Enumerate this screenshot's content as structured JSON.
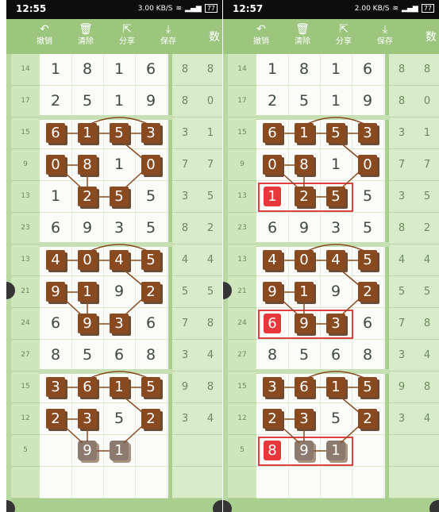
{
  "panels": [
    {
      "id": "left",
      "status": {
        "time": "12:55",
        "speed": "3.00 KB/S",
        "battery": "77"
      },
      "toolbar": [
        {
          "label": "撤销",
          "icon": "undo-icon",
          "glyph": "↶"
        },
        {
          "label": "清除",
          "icon": "trash-icon",
          "glyph": "🗑"
        },
        {
          "label": "分享",
          "icon": "share-icon",
          "glyph": "⇱"
        },
        {
          "label": "保存",
          "icon": "download-icon",
          "glyph": "⤓"
        }
      ],
      "toolbar_more": "数",
      "rows": [
        {
          "n": "14",
          "v": [
            "1",
            "8",
            "1",
            "6"
          ],
          "s": [
            "8",
            "8"
          ]
        },
        {
          "n": "17",
          "v": [
            "2",
            "5",
            "1",
            "9"
          ],
          "s": [
            "8",
            "0"
          ]
        },
        {
          "n": "15",
          "v": [
            "6",
            "1",
            "5",
            "3"
          ],
          "s": [
            "3",
            "1"
          ],
          "hl": [
            0,
            1,
            2,
            3
          ]
        },
        {
          "n": "9",
          "v": [
            "0",
            "8",
            "1",
            "0"
          ],
          "s": [
            "7",
            "7"
          ],
          "hl": [
            0,
            1,
            3
          ]
        },
        {
          "n": "13",
          "v": [
            "1",
            "2",
            "5",
            "5"
          ],
          "s": [
            "3",
            "5"
          ],
          "hl": [
            1,
            2
          ]
        },
        {
          "n": "23",
          "v": [
            "6",
            "9",
            "3",
            "5"
          ],
          "s": [
            "8",
            "2"
          ]
        },
        {
          "n": "13",
          "v": [
            "4",
            "0",
            "4",
            "5"
          ],
          "s": [
            "4",
            "4"
          ],
          "hl": [
            0,
            1,
            2,
            3
          ]
        },
        {
          "n": "21",
          "v": [
            "9",
            "1",
            "9",
            "2"
          ],
          "s": [
            "5",
            "5"
          ],
          "hl": [
            0,
            1,
            3
          ]
        },
        {
          "n": "24",
          "v": [
            "6",
            "9",
            "3",
            "6"
          ],
          "s": [
            "7",
            "8"
          ],
          "hl": [
            1,
            2
          ]
        },
        {
          "n": "27",
          "v": [
            "8",
            "5",
            "6",
            "8"
          ],
          "s": [
            "3",
            "4"
          ]
        },
        {
          "n": "15",
          "v": [
            "3",
            "6",
            "1",
            "5"
          ],
          "s": [
            "9",
            "8"
          ],
          "hl": [
            0,
            1,
            2,
            3
          ]
        },
        {
          "n": "12",
          "v": [
            "2",
            "3",
            "5",
            "2"
          ],
          "s": [
            "3",
            "4"
          ],
          "hl": [
            0,
            1,
            3
          ]
        },
        {
          "n": "5",
          "v": [
            "",
            "9",
            "1",
            ""
          ],
          "s": [
            "",
            ""
          ],
          "faded": [
            1,
            2
          ]
        },
        {
          "n": "",
          "v": [
            "",
            "",
            "",
            ""
          ],
          "s": [
            "",
            ""
          ]
        }
      ]
    },
    {
      "id": "right",
      "status": {
        "time": "12:57",
        "speed": "2.00 KB/S",
        "battery": "77"
      },
      "toolbar": [
        {
          "label": "撤销",
          "icon": "undo-icon",
          "glyph": "↶"
        },
        {
          "label": "清除",
          "icon": "trash-icon",
          "glyph": "🗑"
        },
        {
          "label": "分享",
          "icon": "share-icon",
          "glyph": "⇱"
        },
        {
          "label": "保存",
          "icon": "download-icon",
          "glyph": "⤓"
        }
      ],
      "toolbar_more": "数",
      "rows": [
        {
          "n": "14",
          "v": [
            "1",
            "8",
            "1",
            "6"
          ],
          "s": [
            "8",
            "8"
          ]
        },
        {
          "n": "17",
          "v": [
            "2",
            "5",
            "1",
            "9"
          ],
          "s": [
            "8",
            "0"
          ]
        },
        {
          "n": "15",
          "v": [
            "6",
            "1",
            "5",
            "3"
          ],
          "s": [
            "3",
            "1"
          ],
          "hl": [
            0,
            1,
            2,
            3
          ]
        },
        {
          "n": "9",
          "v": [
            "0",
            "8",
            "1",
            "0"
          ],
          "s": [
            "7",
            "7"
          ],
          "hl": [
            0,
            1,
            3
          ]
        },
        {
          "n": "13",
          "v": [
            "1",
            "2",
            "5",
            "5"
          ],
          "s": [
            "3",
            "5"
          ],
          "hl": [
            1,
            2
          ],
          "red": [
            0
          ],
          "box": true
        },
        {
          "n": "23",
          "v": [
            "6",
            "9",
            "3",
            "5"
          ],
          "s": [
            "8",
            "2"
          ]
        },
        {
          "n": "13",
          "v": [
            "4",
            "0",
            "4",
            "5"
          ],
          "s": [
            "4",
            "4"
          ],
          "hl": [
            0,
            1,
            2,
            3
          ]
        },
        {
          "n": "21",
          "v": [
            "9",
            "1",
            "9",
            "2"
          ],
          "s": [
            "5",
            "5"
          ],
          "hl": [
            0,
            1,
            3
          ]
        },
        {
          "n": "24",
          "v": [
            "6",
            "9",
            "3",
            "6"
          ],
          "s": [
            "7",
            "8"
          ],
          "hl": [
            1,
            2
          ],
          "red": [
            0
          ],
          "box": true
        },
        {
          "n": "27",
          "v": [
            "8",
            "5",
            "6",
            "8"
          ],
          "s": [
            "3",
            "4"
          ]
        },
        {
          "n": "15",
          "v": [
            "3",
            "6",
            "1",
            "5"
          ],
          "s": [
            "9",
            "8"
          ],
          "hl": [
            0,
            1,
            2,
            3
          ]
        },
        {
          "n": "12",
          "v": [
            "2",
            "3",
            "5",
            "2"
          ],
          "s": [
            "3",
            "4"
          ],
          "hl": [
            0,
            1,
            3
          ]
        },
        {
          "n": "5",
          "v": [
            "8",
            "9",
            "1",
            ""
          ],
          "s": [
            "",
            ""
          ],
          "faded": [
            1,
            2
          ],
          "red": [
            0
          ],
          "box": true
        },
        {
          "n": "",
          "v": [
            "",
            "",
            "",
            ""
          ],
          "s": [
            "",
            ""
          ]
        }
      ]
    }
  ]
}
